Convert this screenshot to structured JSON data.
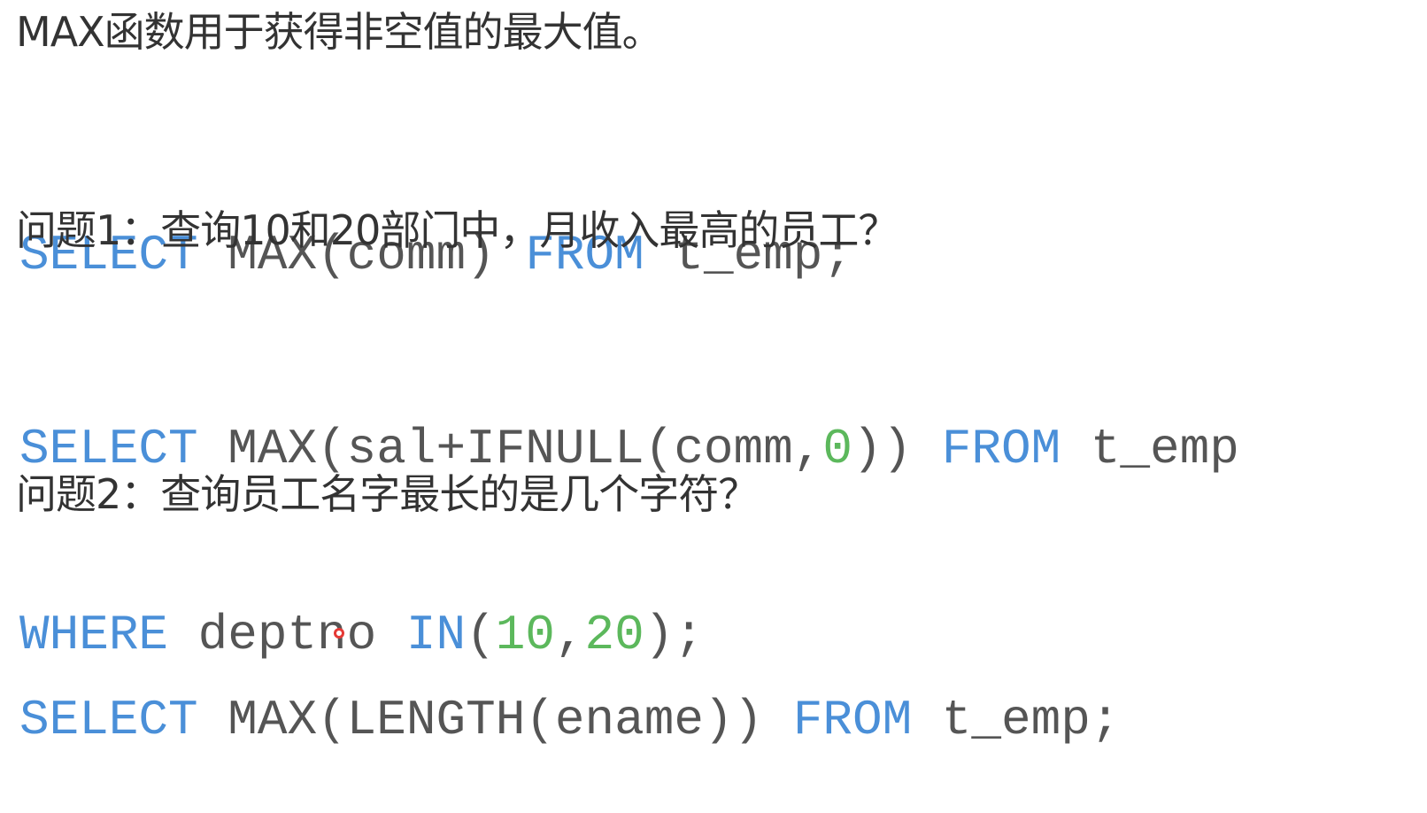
{
  "sections": [
    {
      "heading": "MAX函数用于获得非空值的最大值。",
      "code": [
        [
          {
            "t": "SELECT",
            "k": "kw"
          },
          {
            "t": " ",
            "k": "id"
          },
          {
            "t": "MAX(comm)",
            "k": "id"
          },
          {
            "t": " ",
            "k": "id"
          },
          {
            "t": "FROM",
            "k": "kw"
          },
          {
            "t": " t_emp;",
            "k": "id"
          }
        ]
      ]
    },
    {
      "heading": "问题1：查询10和20部门中，月收入最高的员工？",
      "code": [
        [
          {
            "t": "SELECT",
            "k": "kw"
          },
          {
            "t": " MAX(sal+IFNULL(comm,",
            "k": "id"
          },
          {
            "t": "0",
            "k": "num"
          },
          {
            "t": ")) ",
            "k": "id"
          },
          {
            "t": "FROM",
            "k": "kw"
          },
          {
            "t": " t_emp",
            "k": "id"
          }
        ],
        [
          {
            "t": "WHERE",
            "k": "kw"
          },
          {
            "t": " deptno ",
            "k": "id"
          },
          {
            "t": "IN",
            "k": "kw"
          },
          {
            "t": "(",
            "k": "id"
          },
          {
            "t": "10",
            "k": "num"
          },
          {
            "t": ",",
            "k": "id"
          },
          {
            "t": "20",
            "k": "num"
          },
          {
            "t": ");",
            "k": "id"
          }
        ]
      ]
    },
    {
      "heading": "问题2：查询员工名字最长的是几个字符？",
      "code": [
        [
          {
            "t": "SELECT",
            "k": "kw"
          },
          {
            "t": " MAX(LENGTH(ename)) ",
            "k": "id"
          },
          {
            "t": "FROM",
            "k": "kw"
          },
          {
            "t": " t_emp;",
            "k": "id"
          }
        ]
      ]
    }
  ],
  "colors": {
    "keyword": "#4a8fd8",
    "number": "#5cb85c",
    "identifier": "#555555",
    "heading": "#333333"
  }
}
